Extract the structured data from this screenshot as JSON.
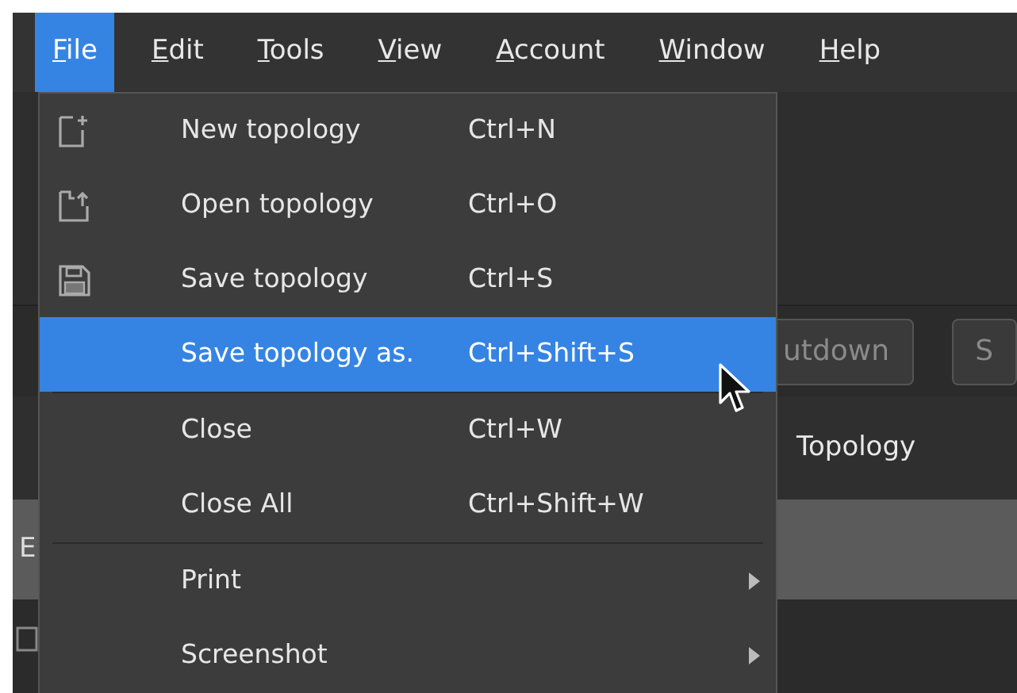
{
  "menubar": [
    {
      "label": "File",
      "selected": true
    },
    {
      "label": "Edit",
      "selected": false
    },
    {
      "label": "Tools",
      "selected": false
    },
    {
      "label": "View",
      "selected": false
    },
    {
      "label": "Account",
      "selected": false
    },
    {
      "label": "Window",
      "selected": false
    },
    {
      "label": "Help",
      "selected": false
    }
  ],
  "background": {
    "buttons": [
      "utdown",
      "S"
    ],
    "tab": "Topology",
    "side_label": "E"
  },
  "file_menu": {
    "items": [
      {
        "kind": "item",
        "label": "New topology",
        "shortcut": "Ctrl+N",
        "selected": false
      },
      {
        "kind": "item",
        "label": "Open topology",
        "shortcut": "Ctrl+O",
        "selected": false
      },
      {
        "kind": "item",
        "label": "Save topology",
        "shortcut": "Ctrl+S",
        "selected": false
      },
      {
        "kind": "item",
        "label": "Save topology as.",
        "shortcut": "Ctrl+Shift+S",
        "selected": true
      },
      {
        "kind": "separator"
      },
      {
        "kind": "item",
        "label": "Close",
        "shortcut": "Ctrl+W",
        "selected": false
      },
      {
        "kind": "item",
        "label": "Close All",
        "shortcut": "Ctrl+Shift+W",
        "selected": false
      },
      {
        "kind": "separator"
      },
      {
        "kind": "item",
        "label": "Print",
        "submenu": true,
        "selected": false
      },
      {
        "kind": "item",
        "label": "Screenshot",
        "submenu": true,
        "selected": false
      }
    ]
  }
}
